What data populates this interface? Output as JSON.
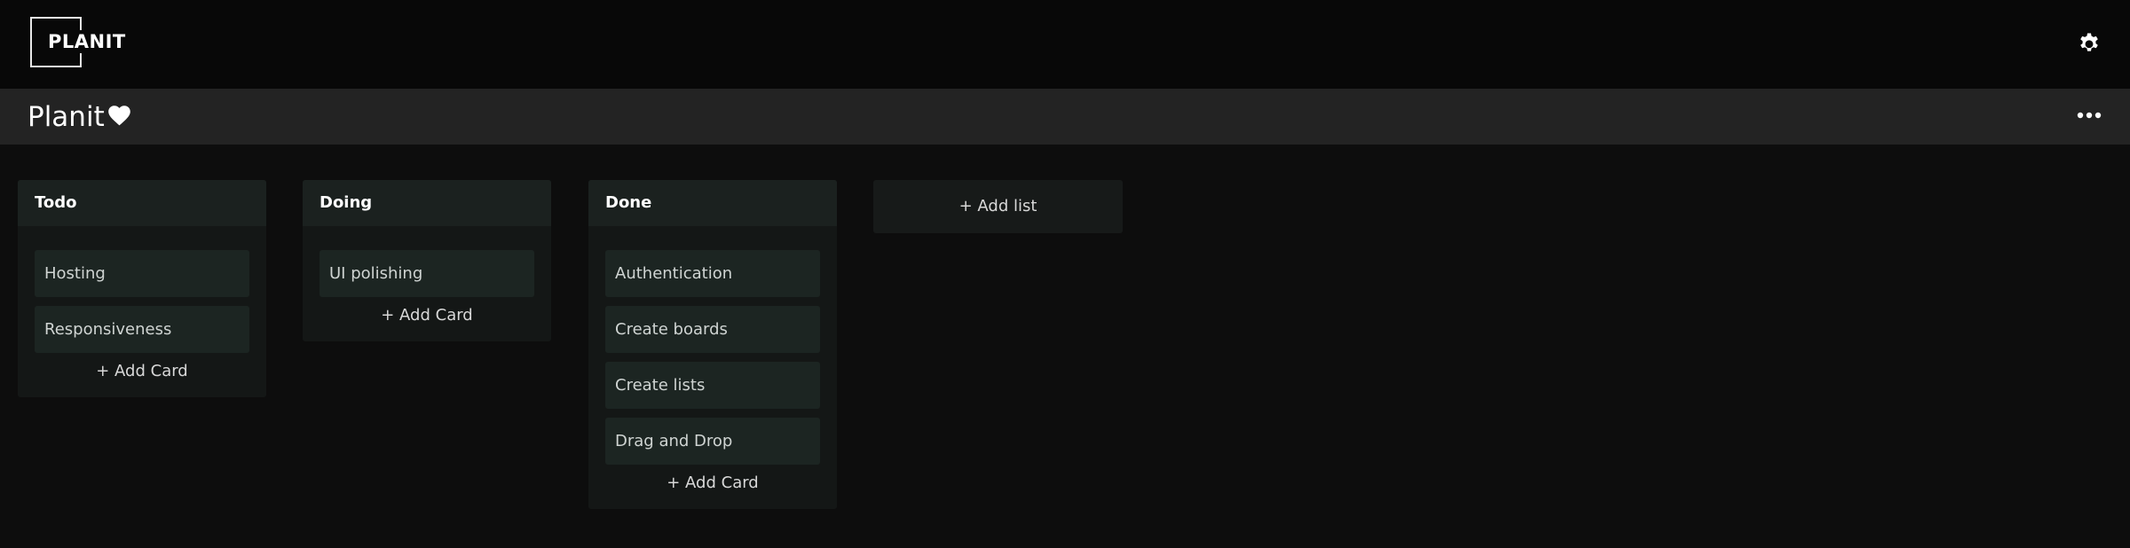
{
  "header": {
    "logo_text": "PLANIT",
    "settings_icon": "gear-icon"
  },
  "board": {
    "title": "Planit",
    "favorite_icon": "heart-icon",
    "menu_icon": "more-horizontal-icon"
  },
  "lists": [
    {
      "title": "Todo",
      "cards": [
        "Hosting",
        "Responsiveness"
      ],
      "add_card_label": "+ Add Card"
    },
    {
      "title": "Doing",
      "cards": [
        "UI polishing"
      ],
      "add_card_label": "+ Add Card"
    },
    {
      "title": "Done",
      "cards": [
        "Authentication",
        "Create boards",
        "Create lists",
        "Drag and Drop"
      ],
      "add_card_label": "+ Add Card"
    }
  ],
  "add_list_label": "+ Add list",
  "colors": {
    "background": "#0d0d0d",
    "topbar": "#080808",
    "boardbar": "#232323",
    "list_header": "#1b211f",
    "card": "#1c2522"
  }
}
